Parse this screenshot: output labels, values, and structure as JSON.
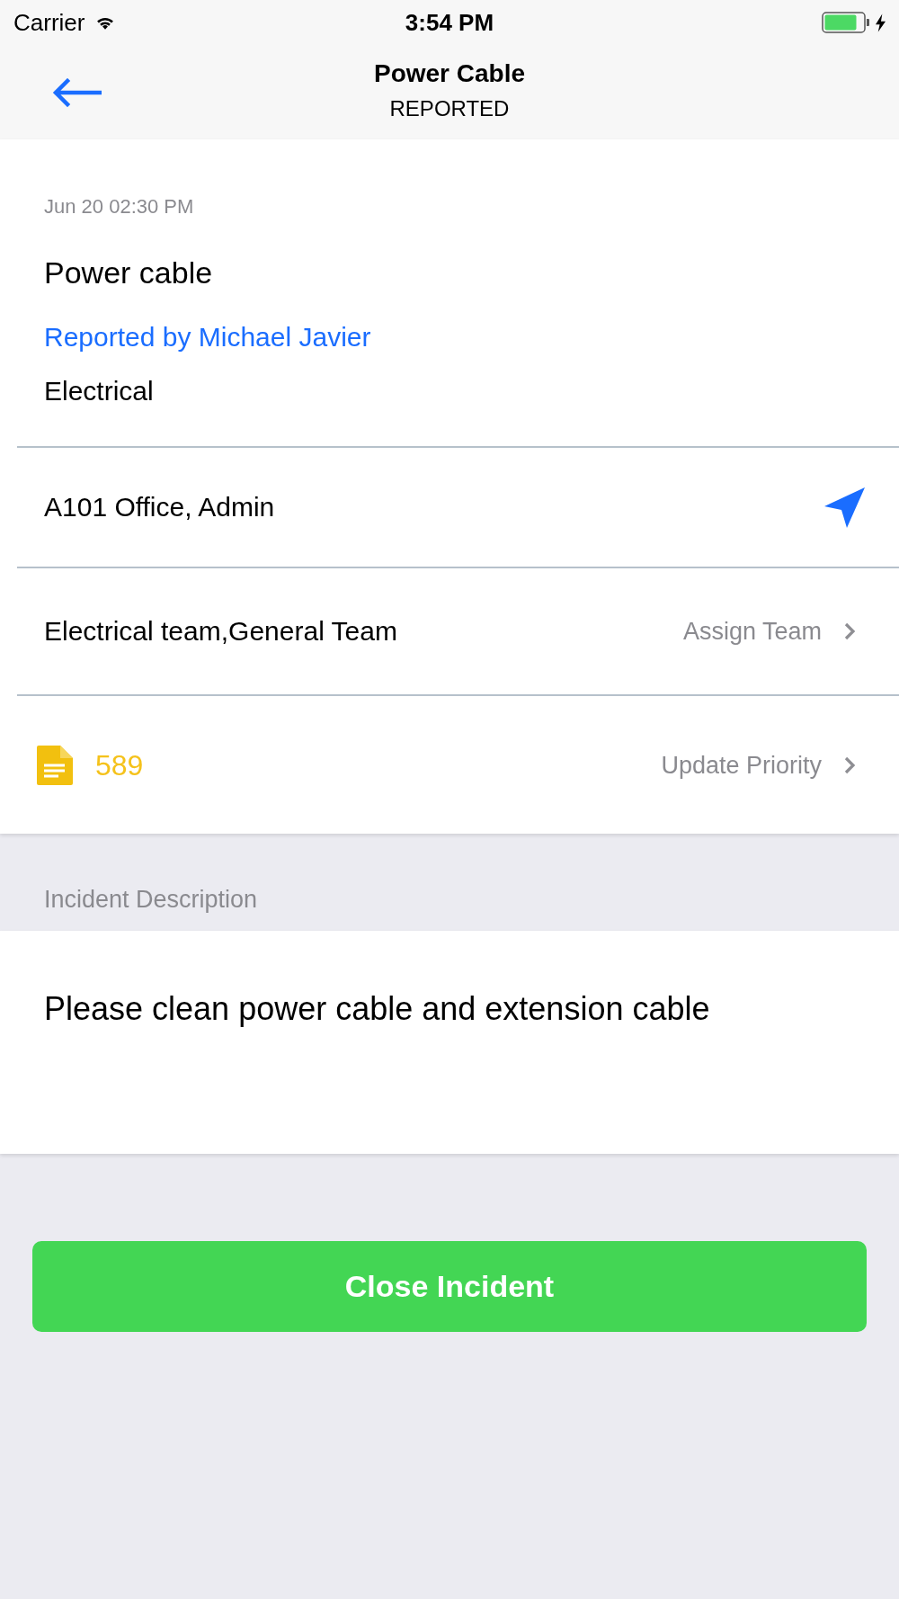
{
  "status_bar": {
    "carrier": "Carrier",
    "time": "3:54 PM"
  },
  "nav_bar": {
    "title": "Power Cable",
    "subtitle": "REPORTED"
  },
  "incident": {
    "timestamp": "Jun 20 02:30 PM",
    "title": "Power cable",
    "reported_by": "Reported by Michael Javier",
    "category": "Electrical"
  },
  "rows": [
    {
      "kind": "location",
      "text": "A101 Office, Admin"
    },
    {
      "kind": "team",
      "text": "Electrical team,General Team",
      "action": "Assign Team"
    },
    {
      "kind": "priority",
      "text": "589",
      "action": "Update Priority"
    }
  ],
  "description": {
    "label": "Incident Description",
    "text": "Please clean power cable and extension cable"
  },
  "buttons": [
    {
      "label": "Close Incident"
    }
  ]
}
